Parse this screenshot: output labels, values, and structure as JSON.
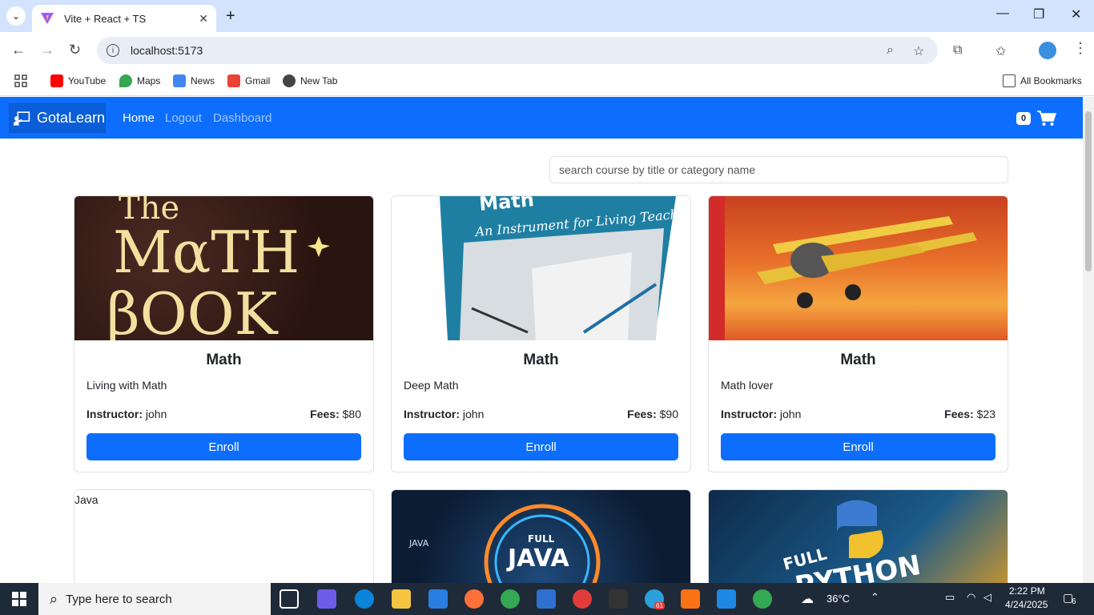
{
  "browser": {
    "tab_title": "Vite + React + TS",
    "url": "localhost:5173",
    "bookmarks": [
      {
        "label": "YouTube",
        "color": "#ff0000"
      },
      {
        "label": "Maps",
        "color": "#34a853"
      },
      {
        "label": "News",
        "color": "#4285f4"
      },
      {
        "label": "Gmail",
        "color": "#ea4335"
      },
      {
        "label": "New Tab",
        "color": "#444444"
      }
    ],
    "all_bookmarks": "All Bookmarks"
  },
  "app": {
    "brand": "GotaLearn",
    "nav": [
      {
        "label": "Home",
        "active": true
      },
      {
        "label": "Logout",
        "active": false
      },
      {
        "label": "Dashboard",
        "active": false
      }
    ],
    "cart_count": "0",
    "search_placeholder": "search course by title or category name",
    "accent_color": "#0d6efd",
    "courses": [
      {
        "category": "Math",
        "title": "Living with Math",
        "instructor_label": "Instructor:",
        "instructor": "john",
        "fees_label": "Fees:",
        "fees": "$80",
        "enroll": "Enroll",
        "image": "the-math-book-cover"
      },
      {
        "category": "Math",
        "title": "Deep Math",
        "instructor_label": "Instructor:",
        "instructor": "john",
        "fees_label": "Fees:",
        "fees": "$90",
        "enroll": "Enroll",
        "image": "instrument-for-living-teaching-cover"
      },
      {
        "category": "Math",
        "title": "Math lover",
        "instructor_label": "Instructor:",
        "instructor": "john",
        "fees_label": "Fees:",
        "fees": "$23",
        "enroll": "Enroll",
        "image": "biplane-sunset"
      }
    ],
    "second_row": [
      {
        "alt": "Java",
        "image": "broken-image"
      },
      {
        "text_big": "JAVA",
        "text_small": "FULL",
        "image": "full-java-course"
      },
      {
        "text_big": "PYTHON",
        "text_small": "FULL",
        "image": "full-python-course"
      }
    ]
  },
  "taskbar": {
    "search_placeholder": "Type here to search",
    "weather": "36°C",
    "time": "2:22 PM",
    "date": "4/24/2025",
    "notifications": "6",
    "telegram_badge": "61"
  }
}
